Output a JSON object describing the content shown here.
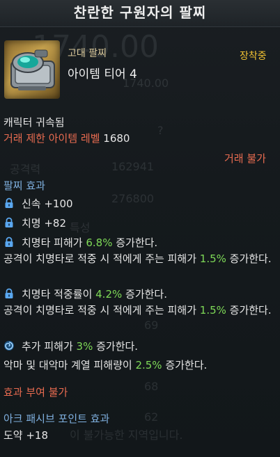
{
  "title": "찬란한 구원자의 팔찌",
  "background_text": [
    "1740.00",
    "1740.00",
    "?",
    "공격력",
    "162941",
    "276800",
    "특성",
    "69",
    "68",
    "62",
    "이 불가능한 지역입니다."
  ],
  "item": {
    "grade": "고대 팔찌",
    "tier": "아이템 티어 4",
    "equipped": "장착중",
    "bound": "캐릭터 귀속됨",
    "trade_limit_label": "거래 제한 아이템 레벨",
    "trade_limit_value": "1680",
    "tradeable": "거래 불가"
  },
  "effects": {
    "header": "팔찌 효과",
    "stat1": "신속 +100",
    "stat2": "치명 +82",
    "crit_dmg_pre": "치명타 피해가 ",
    "crit_dmg_val": "6.8%",
    "crit_dmg_post": " 증가한다.",
    "crit_dmg_sub_pre": "공격이 치명타로 적중 시 적에게 주는 피해가 ",
    "crit_dmg_sub_val": "1.5%",
    "crit_dmg_sub_post": " 증가한다.",
    "crit_rate_pre": "치명타 적중률이 ",
    "crit_rate_val": "4.2%",
    "crit_rate_post": " 증가한다.",
    "crit_rate_sub_pre": "공격이 치명타로 적중 시 적에게 주는 피해가 ",
    "crit_rate_sub_val": "1.5%",
    "crit_rate_sub_post": " 증가한다.",
    "extra_dmg_pre": "추가 피해가 ",
    "extra_dmg_val": "3%",
    "extra_dmg_post": " 증가한다.",
    "demon_pre": "악마 및 대악마 계열 피해량이 ",
    "demon_val": "2.5%",
    "demon_post": " 증가한다."
  },
  "no_effect": "효과 부여 불가",
  "arc_passive": {
    "header": "아크 패시브 포인트 효과",
    "value": "도약 +18"
  },
  "colors": {
    "accent_blue": "#7fb0df",
    "warning_red": "#e86b50",
    "value_green": "#7ed957",
    "equipped_gold": "#f1c232"
  },
  "icons": [
    "lock-icon",
    "swirl-icon",
    "bracelet-item-icon"
  ]
}
